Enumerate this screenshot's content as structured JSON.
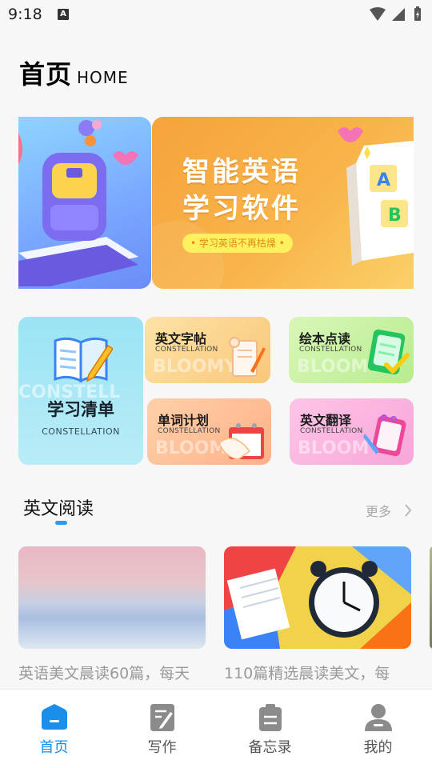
{
  "status_bar": {
    "time": "9:18",
    "badge": "A"
  },
  "header": {
    "title": "首页",
    "subtitle": "HOME"
  },
  "banner": {
    "heading_line1": "智能英语",
    "heading_line2": "学习软件",
    "tagline": "• 学习英语不再枯燥 •"
  },
  "features": {
    "study_list": {
      "label": "学习清单",
      "sub": "CONSTELLATION"
    },
    "copybook": {
      "label": "英文字帖",
      "sub": "CONSTELLATION"
    },
    "picture_book": {
      "label": "绘本点读",
      "sub": "CONSTELLATION"
    },
    "word_plan": {
      "label": "单词计划",
      "sub": "CONSTELLATION"
    },
    "translate": {
      "label": "英文翻译",
      "sub": "CONSTELLATION"
    }
  },
  "reading": {
    "title": "英文阅读",
    "more": "更多",
    "articles": [
      {
        "title": "英语美文晨读60篇，每天"
      },
      {
        "title": "110篇精选晨读美文，每"
      }
    ]
  },
  "tabs": [
    {
      "label": "首页",
      "icon": "home-icon",
      "active": true
    },
    {
      "label": "写作",
      "icon": "write-icon",
      "active": false
    },
    {
      "label": "备忘录",
      "icon": "memo-icon",
      "active": false
    },
    {
      "label": "我的",
      "icon": "profile-icon",
      "active": false
    }
  ],
  "colors": {
    "accent": "#1a8ee8",
    "banner_orange": "#f6a33b",
    "underline": "#2d9cf0"
  }
}
